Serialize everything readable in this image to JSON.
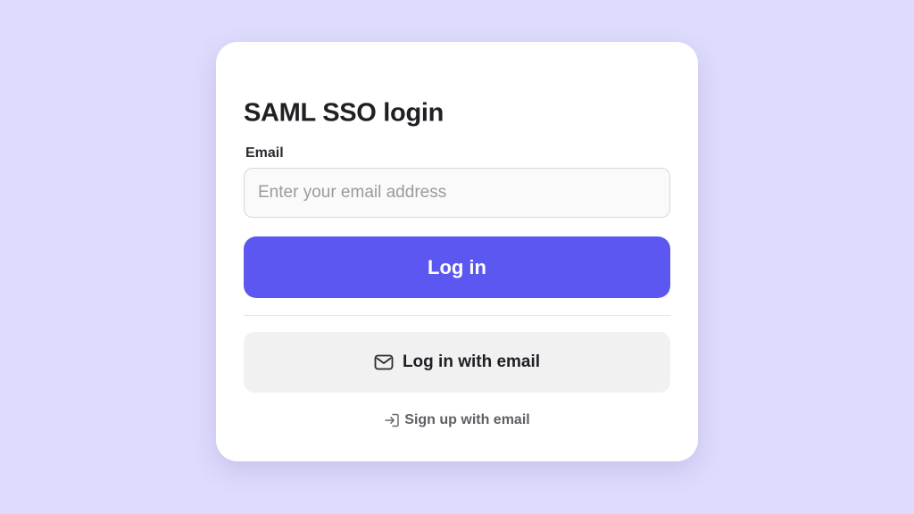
{
  "login": {
    "title": "SAML SSO login",
    "email_label": "Email",
    "email_placeholder": "Enter your email address",
    "email_value": "",
    "login_button": "Log in",
    "email_login_button": "Log in with email",
    "email_login_icon": "mail-icon",
    "signup_link": "Sign up with email",
    "signup_icon": "sign-in-arrow-icon"
  },
  "colors": {
    "background": "#dedcfc",
    "card": "#ffffff",
    "primary_button": "#5b57f0",
    "secondary_button": "#f1f1f1"
  }
}
